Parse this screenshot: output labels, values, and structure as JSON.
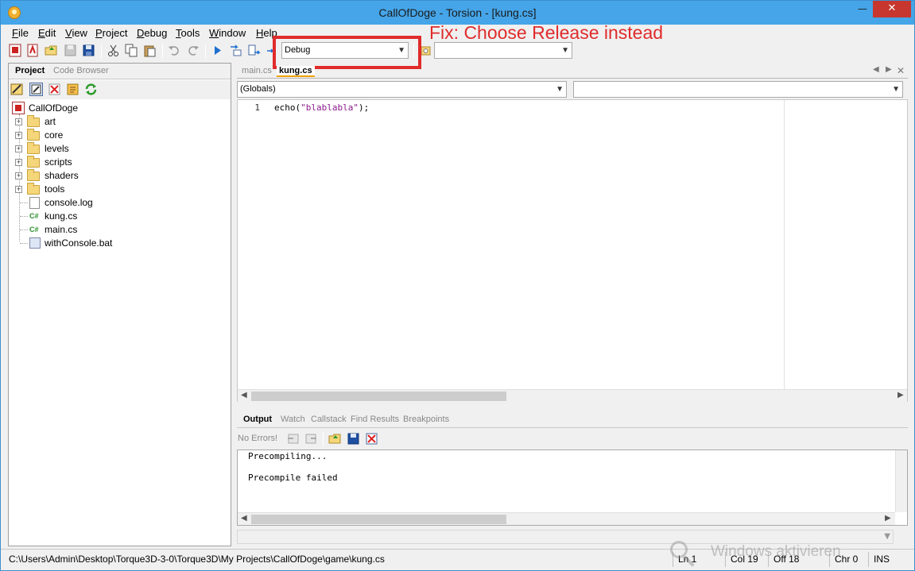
{
  "window": {
    "title": "CallOfDoge - Torsion - [kung.cs]"
  },
  "menu": [
    "File",
    "Edit",
    "View",
    "Project",
    "Debug",
    "Tools",
    "Window",
    "Help"
  ],
  "toolbar": {
    "config_value": "Debug",
    "target_value": ""
  },
  "annotation": {
    "text": "Fix: Choose Release instead",
    "color": "#e02b2b"
  },
  "left_tabs": [
    "Project",
    "Code Browser"
  ],
  "tree": {
    "root": "CallOfDoge",
    "folders": [
      "art",
      "core",
      "levels",
      "scripts",
      "shaders",
      "tools"
    ],
    "files": [
      {
        "name": "console.log",
        "icon": "file-icon"
      },
      {
        "name": "kung.cs",
        "icon": "cs-icon"
      },
      {
        "name": "main.cs",
        "icon": "cs-icon"
      },
      {
        "name": "withConsole.bat",
        "icon": "bat-icon"
      }
    ]
  },
  "editor_tabs": [
    "main.cs",
    "kung.cs"
  ],
  "globals": {
    "scope_value": "(Globals)",
    "member_value": ""
  },
  "editor": {
    "line_number": "1",
    "code_prefix": "echo(",
    "code_string": "\"blablabla\"",
    "code_suffix": ");"
  },
  "output_tabs": [
    "Output",
    "Watch",
    "Callstack",
    "Find Results",
    "Breakpoints"
  ],
  "output": {
    "no_errors": "No Errors!",
    "lines": [
      "Precompiling...",
      "",
      "Precompile failed"
    ]
  },
  "status": {
    "path": "C:\\Users\\Admin\\Desktop\\Torque3D-3-0\\Torque3D\\My Projects\\CallOfDoge\\game\\kung.cs",
    "ln": "Ln 1",
    "col": "Col 19",
    "off": "Off 18",
    "chr": "Chr 0",
    "ins": "INS"
  },
  "watermark": "Windows aktivieren"
}
